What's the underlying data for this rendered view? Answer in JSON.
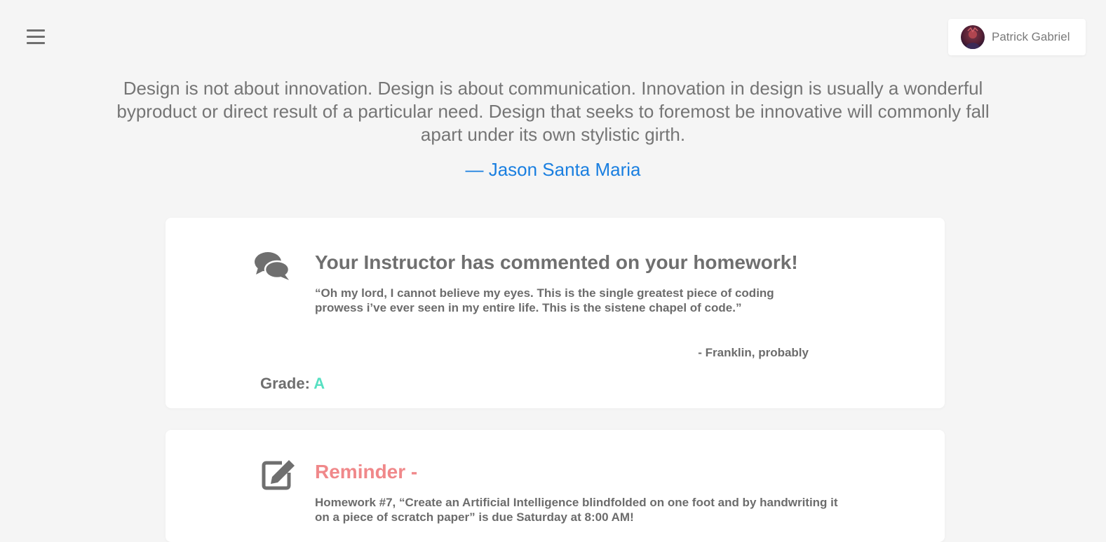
{
  "header": {
    "menu_icon": "hamburger-menu-icon",
    "user": {
      "name": "Patrick Gabriel",
      "avatar_icon": "user-avatar"
    }
  },
  "quote": {
    "text": "Design is not about innovation. Design is about communication. Innovation in design is usually a wonderful byproduct or direct result of a particular need. Design that seeks to foremost be innovative will commonly fall apart under its own stylistic girth.",
    "author": "— Jason Santa Maria",
    "author_color": "#1a7fe0"
  },
  "cards": [
    {
      "icon": "comments-icon",
      "title": "Your Instructor has commented on your homework!",
      "title_color": "#6f6f6f",
      "body": "“Oh my lord, I cannot believe my eyes. This is the single greatest piece of coding prowess i’ve ever seen in my entire life. This is the sistene chapel of code.”",
      "attribution": "- Franklin, probably",
      "grade_label": "Grade:",
      "grade_value": "A",
      "grade_color": "#57e0c2"
    },
    {
      "icon": "edit-icon",
      "title": "Reminder -",
      "title_color": "#f0888a",
      "body": "Homework #7, “Create an Artificial Intelligence blindfolded on one foot and by handwriting it on a piece of scratch paper” is due Saturday at 8:00 AM!"
    }
  ]
}
